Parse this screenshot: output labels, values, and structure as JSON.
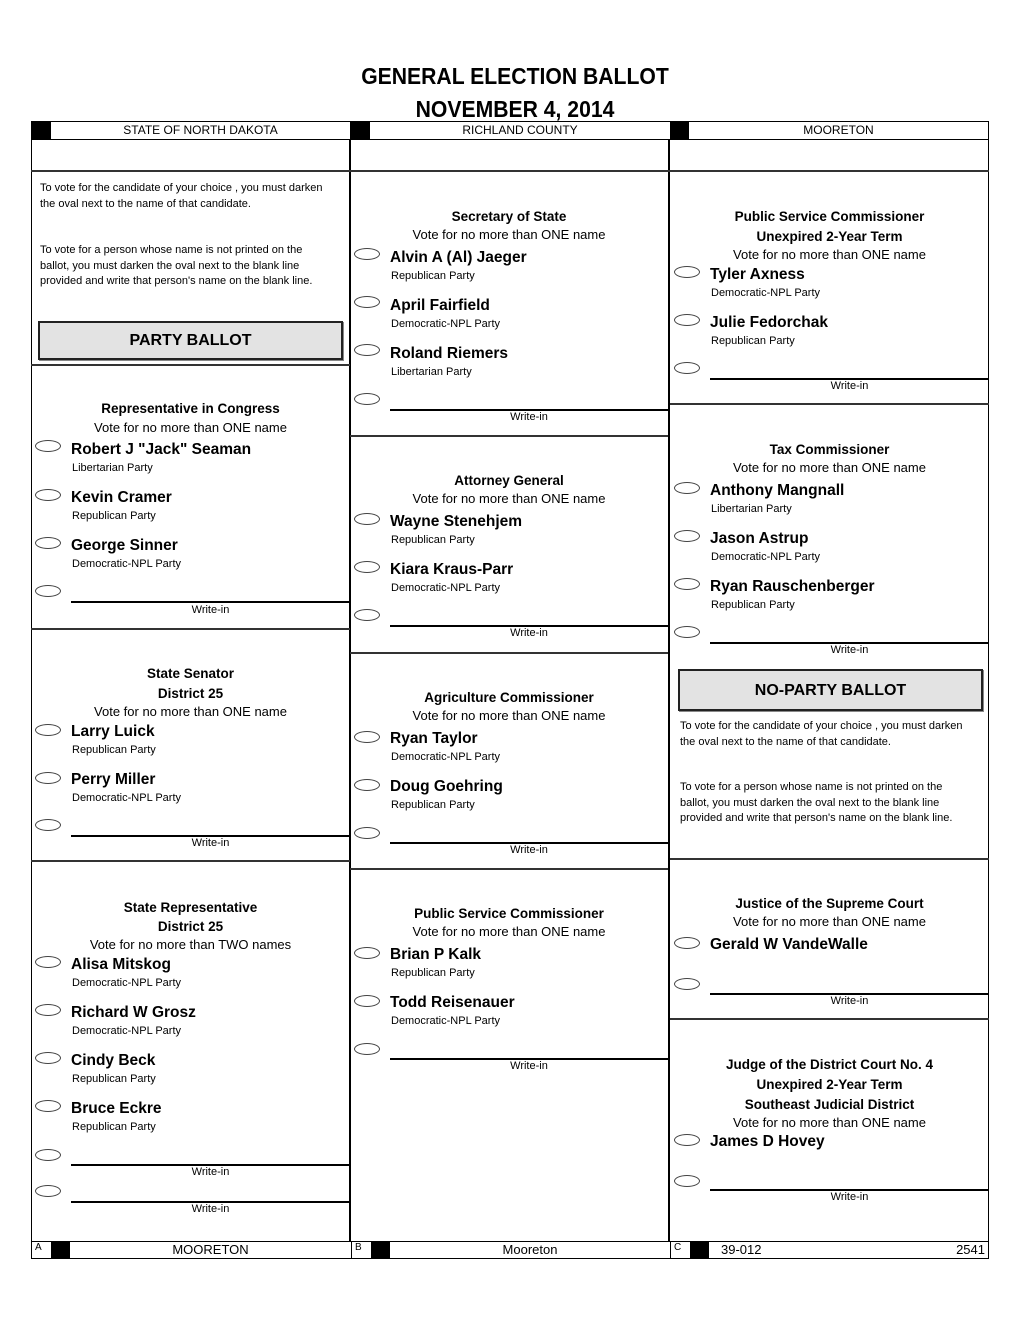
{
  "header": {
    "title": "GENERAL ELECTION BALLOT",
    "date": "NOVEMBER  4, 2014",
    "cells": [
      "STATE OF NORTH DAKOTA",
      "RICHLAND COUNTY",
      "MOORETON"
    ]
  },
  "instructions": {
    "para1": "To vote for the candidate of your choice , you must darken the oval next to the name of that candidate.",
    "para2": "To vote for a person whose name is not printed on the ballot, you must darken the oval next to the blank line provided and write that person's name on the blank line."
  },
  "party_ballot_label": "PARTY BALLOT",
  "no_party_ballot_label": "NO-PARTY BALLOT",
  "write_in_label": "Write-in",
  "contests": {
    "congress": {
      "title": "Representative in Congress",
      "vote": "Vote for no more than ONE name",
      "candidates": [
        {
          "name": "Robert J \"Jack\" Seaman",
          "party": "Libertarian Party"
        },
        {
          "name": "Kevin Cramer",
          "party": "Republican Party"
        },
        {
          "name": "George Sinner",
          "party": "Democratic-NPL Party"
        }
      ]
    },
    "senator": {
      "title": "State Senator",
      "subtitle": "District 25",
      "vote": "Vote for no more than ONE name",
      "candidates": [
        {
          "name": "Larry Luick",
          "party": "Republican Party"
        },
        {
          "name": "Perry Miller",
          "party": "Democratic-NPL Party"
        }
      ]
    },
    "representative": {
      "title": "State Representative",
      "subtitle": "District 25",
      "vote": "Vote for no more than TWO names",
      "candidates": [
        {
          "name": "Alisa Mitskog",
          "party": "Democratic-NPL Party"
        },
        {
          "name": "Richard W Grosz",
          "party": "Democratic-NPL Party"
        },
        {
          "name": "Cindy Beck",
          "party": "Republican Party"
        },
        {
          "name": "Bruce Eckre",
          "party": "Republican Party"
        }
      ]
    },
    "secretary": {
      "title": "Secretary of State",
      "vote": "Vote for no more than ONE name",
      "candidates": [
        {
          "name": "Alvin A (Al) Jaeger",
          "party": "Republican Party"
        },
        {
          "name": "April Fairfield",
          "party": "Democratic-NPL Party"
        },
        {
          "name": "Roland Riemers",
          "party": "Libertarian Party"
        }
      ]
    },
    "attorney": {
      "title": "Attorney General",
      "vote": "Vote for no more than ONE name",
      "candidates": [
        {
          "name": "Wayne Stenehjem",
          "party": "Republican Party"
        },
        {
          "name": "Kiara Kraus-Parr",
          "party": "Democratic-NPL Party"
        }
      ]
    },
    "agriculture": {
      "title": "Agriculture Commissioner",
      "vote": "Vote for no more than ONE name",
      "candidates": [
        {
          "name": "Ryan Taylor",
          "party": "Democratic-NPL Party"
        },
        {
          "name": "Doug Goehring",
          "party": "Republican Party"
        }
      ]
    },
    "psc": {
      "title": "Public Service Commissioner",
      "vote": "Vote for no more than ONE name",
      "candidates": [
        {
          "name": "Brian P Kalk",
          "party": "Republican Party"
        },
        {
          "name": "Todd Reisenauer",
          "party": "Democratic-NPL Party"
        }
      ]
    },
    "psc_unexpired": {
      "title": "Public Service Commissioner",
      "subtitle": "Unexpired 2-Year Term",
      "vote": "Vote for no more than ONE name",
      "candidates": [
        {
          "name": "Tyler Axness",
          "party": "Democratic-NPL Party"
        },
        {
          "name": "Julie Fedorchak",
          "party": "Republican Party"
        }
      ]
    },
    "tax": {
      "title": "Tax Commissioner",
      "vote": "Vote for no more than ONE name",
      "candidates": [
        {
          "name": "Anthony Mangnall",
          "party": "Libertarian Party"
        },
        {
          "name": "Jason Astrup",
          "party": "Democratic-NPL Party"
        },
        {
          "name": "Ryan Rauschenberger",
          "party": "Republican Party"
        }
      ]
    },
    "supreme": {
      "title": "Justice of the Supreme Court",
      "vote": "Vote for no more than ONE name",
      "candidates": [
        {
          "name": "Gerald W VandeWalle"
        }
      ]
    },
    "district": {
      "title": "Judge of the District Court No. 4",
      "subtitle": "Unexpired 2-Year Term",
      "subtitle2": "Southeast Judicial District",
      "vote": "Vote for no more than ONE name",
      "candidates": [
        {
          "name": "James D Hovey"
        }
      ]
    }
  },
  "footer": {
    "a_letter": "A",
    "a_text": "MOORETON",
    "b_letter": "B",
    "b_text": "Mooreton",
    "c_letter": "C",
    "c_code": "39-012",
    "c_number": "2541"
  }
}
